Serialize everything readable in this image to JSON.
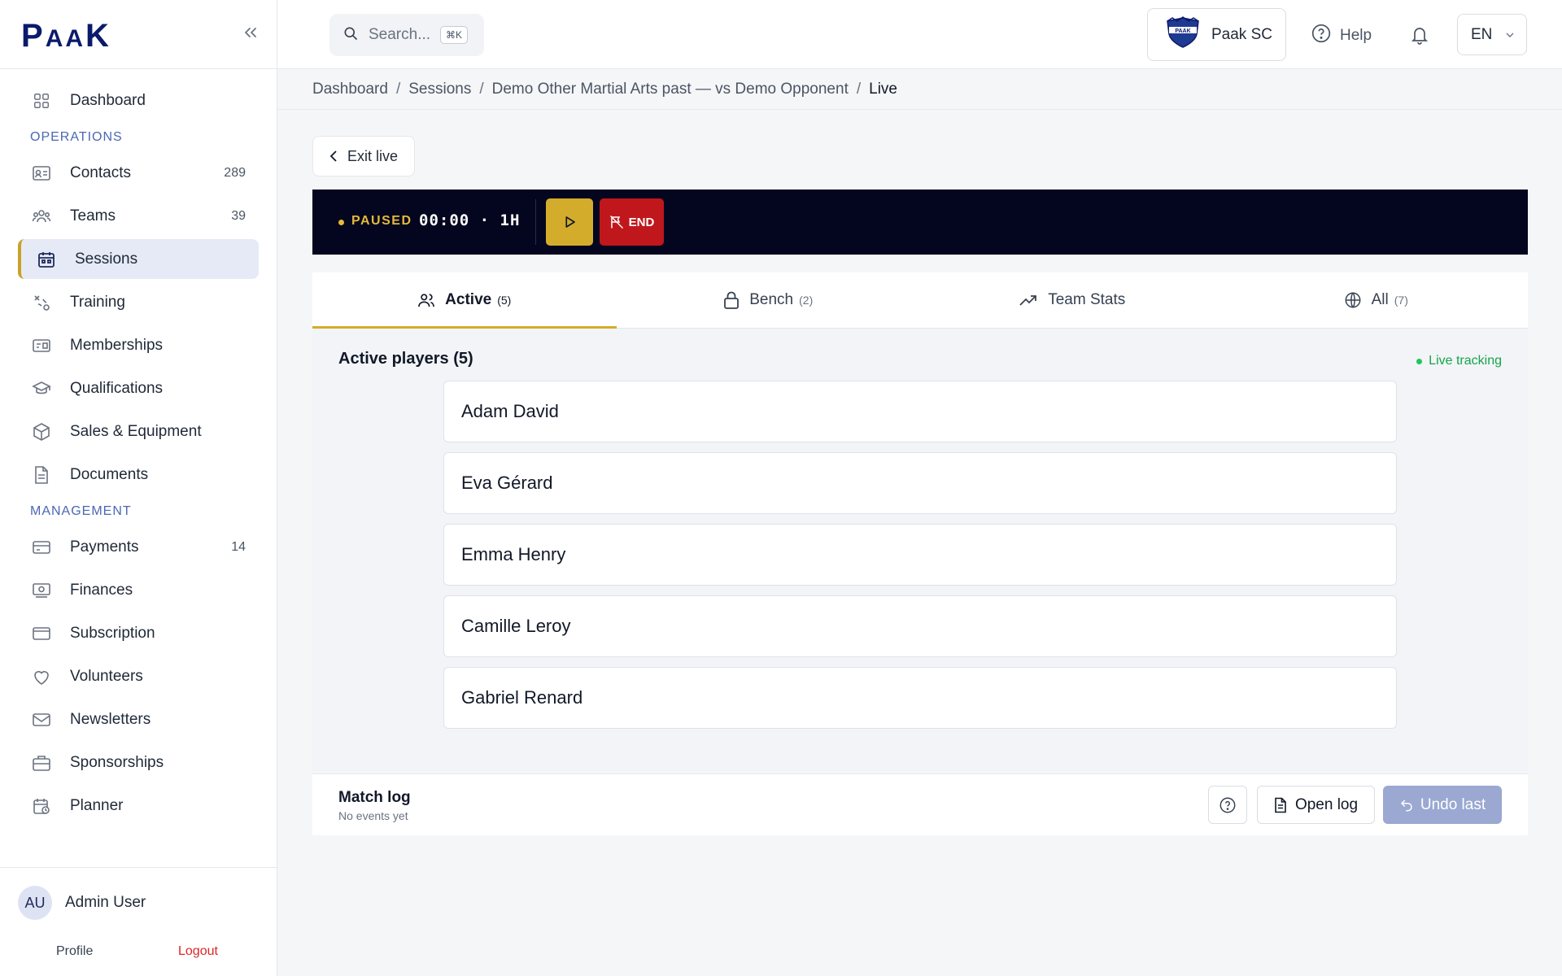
{
  "brand": {
    "logo_text_big1": "P",
    "logo_text_small": "AA",
    "logo_text_big2": "K"
  },
  "sidebar": {
    "items_top": [
      {
        "label": "Dashboard",
        "icon": "dashboard-icon"
      }
    ],
    "operations_title": "OPERATIONS",
    "operations": [
      {
        "label": "Contacts",
        "count": "289",
        "icon": "contacts-icon"
      },
      {
        "label": "Teams",
        "count": "39",
        "icon": "teams-icon"
      },
      {
        "label": "Sessions",
        "count": "",
        "icon": "calendar-icon",
        "active": true
      },
      {
        "label": "Training",
        "count": "",
        "icon": "training-icon"
      },
      {
        "label": "Memberships",
        "count": "",
        "icon": "membership-icon"
      },
      {
        "label": "Qualifications",
        "count": "",
        "icon": "graduation-icon"
      },
      {
        "label": "Sales & Equipment",
        "count": "",
        "icon": "box-icon"
      },
      {
        "label": "Documents",
        "count": "",
        "icon": "document-icon"
      }
    ],
    "management_title": "MANAGEMENT",
    "management": [
      {
        "label": "Payments",
        "count": "14",
        "icon": "card-icon"
      },
      {
        "label": "Finances",
        "count": "",
        "icon": "money-icon"
      },
      {
        "label": "Subscription",
        "count": "",
        "icon": "subscription-icon"
      },
      {
        "label": "Volunteers",
        "count": "",
        "icon": "heart-icon"
      },
      {
        "label": "Newsletters",
        "count": "",
        "icon": "mail-icon"
      },
      {
        "label": "Sponsorships",
        "count": "",
        "icon": "briefcase-icon"
      },
      {
        "label": "Planner",
        "count": "",
        "icon": "planner-icon"
      }
    ],
    "user": {
      "initials": "AU",
      "name": "Admin User",
      "profile_label": "Profile",
      "logout_label": "Logout"
    }
  },
  "topbar": {
    "search_placeholder": "Search...",
    "search_shortcut": "⌘K",
    "club_name": "Paak SC",
    "help_label": "Help",
    "language": "EN"
  },
  "breadcrumb": [
    "Dashboard",
    "Sessions",
    "Demo Other Martial Arts past — vs Demo Opponent",
    "Live"
  ],
  "exit_label": "Exit live",
  "live": {
    "status": "PAUSED",
    "timer": "00:00 · 1H",
    "end_label": "END"
  },
  "tabs": [
    {
      "label": "Active",
      "count": "(5)",
      "icon": "users-icon",
      "active": true
    },
    {
      "label": "Bench",
      "count": "(2)",
      "icon": "lock-icon"
    },
    {
      "label": "Team Stats",
      "count": "",
      "icon": "trending-icon"
    },
    {
      "label": "All",
      "count": "(7)",
      "icon": "globe-icon"
    }
  ],
  "active_panel": {
    "title": "Active players (5)",
    "live_tracking": "Live tracking",
    "players": [
      "Adam David",
      "Eva Gérard",
      "Emma Henry",
      "Camille Leroy",
      "Gabriel Renard"
    ]
  },
  "match_log": {
    "title": "Match log",
    "subtitle": "No events yet",
    "open_label": "Open log",
    "undo_label": "Undo last"
  },
  "colors": {
    "accent_gold": "#d4ac2b",
    "brand_navy": "#0b1a6b",
    "end_red": "#c0171d",
    "live_green": "#16a34a"
  }
}
